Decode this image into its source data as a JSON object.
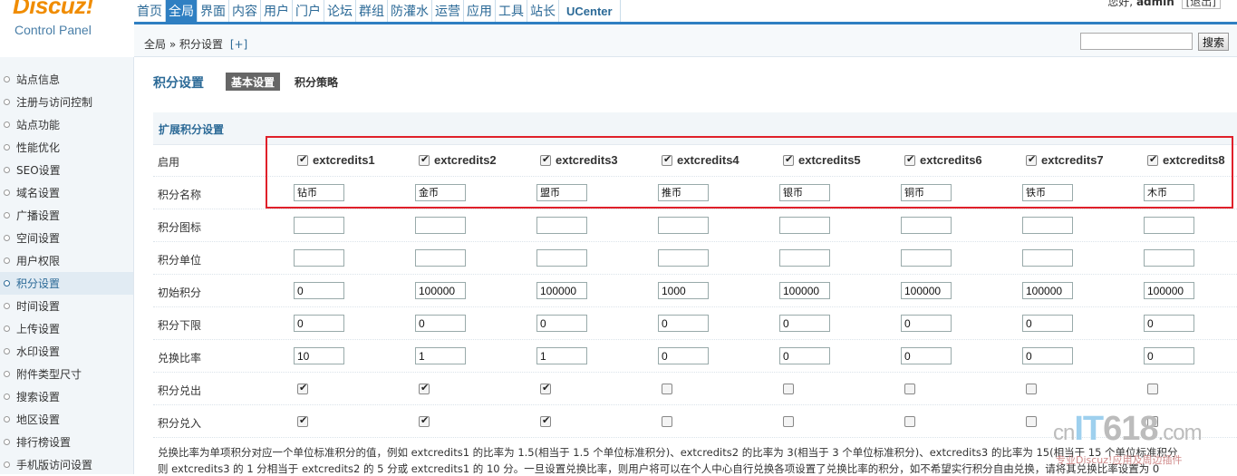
{
  "header": {
    "brand": "Discuz!",
    "subtitle": "Control Panel",
    "nav": [
      "首页",
      "全局",
      "界面",
      "内容",
      "用户",
      "门户",
      "论坛",
      "群组",
      "防灌水",
      "运营",
      "应用",
      "工具",
      "站长",
      "UCenter"
    ],
    "active_nav": "全局",
    "greeting": "您好,",
    "username": "admin",
    "logout": "[退出]"
  },
  "breadcrumb": {
    "text": "全局 » 积分设置",
    "add": "[+]"
  },
  "search": {
    "value": "",
    "button": "搜索"
  },
  "sidebar": {
    "items": [
      "站点信息",
      "注册与访问控制",
      "站点功能",
      "性能优化",
      "SEO设置",
      "域名设置",
      "广播设置",
      "空间设置",
      "用户权限",
      "积分设置",
      "时间设置",
      "上传设置",
      "水印设置",
      "附件类型尺寸",
      "搜索设置",
      "地区设置",
      "排行榜设置",
      "手机版访问设置"
    ],
    "active": "积分设置"
  },
  "page": {
    "title": "积分设置",
    "tabs": [
      "基本设置",
      "积分策略"
    ],
    "active_tab": "基本设置"
  },
  "section": {
    "title": "扩展积分设置"
  },
  "row_labels": {
    "enable": "启用",
    "name": "积分名称",
    "icon": "积分图标",
    "unit": "积分单位",
    "initial": "初始积分",
    "lower": "积分下限",
    "ratio": "兑换比率",
    "out": "积分兑出",
    "in": "积分兑入"
  },
  "credits": [
    {
      "key": "extcredits1",
      "enabled": true,
      "name": "钻币",
      "icon": "",
      "unit": "",
      "initial": "0",
      "lower": "0",
      "ratio": "10",
      "out": true,
      "in": true
    },
    {
      "key": "extcredits2",
      "enabled": true,
      "name": "金币",
      "icon": "",
      "unit": "",
      "initial": "100000",
      "lower": "0",
      "ratio": "1",
      "out": true,
      "in": true
    },
    {
      "key": "extcredits3",
      "enabled": true,
      "name": "盟币",
      "icon": "",
      "unit": "",
      "initial": "100000",
      "lower": "0",
      "ratio": "1",
      "out": true,
      "in": true
    },
    {
      "key": "extcredits4",
      "enabled": true,
      "name": "推币",
      "icon": "",
      "unit": "",
      "initial": "1000",
      "lower": "0",
      "ratio": "0",
      "out": false,
      "in": false
    },
    {
      "key": "extcredits5",
      "enabled": true,
      "name": "银币",
      "icon": "",
      "unit": "",
      "initial": "100000",
      "lower": "0",
      "ratio": "0",
      "out": false,
      "in": false
    },
    {
      "key": "extcredits6",
      "enabled": true,
      "name": "铜币",
      "icon": "",
      "unit": "",
      "initial": "100000",
      "lower": "0",
      "ratio": "0",
      "out": false,
      "in": false
    },
    {
      "key": "extcredits7",
      "enabled": true,
      "name": "铁币",
      "icon": "",
      "unit": "",
      "initial": "100000",
      "lower": "0",
      "ratio": "0",
      "out": false,
      "in": false
    },
    {
      "key": "extcredits8",
      "enabled": true,
      "name": "木币",
      "icon": "",
      "unit": "",
      "initial": "100000",
      "lower": "0",
      "ratio": "0",
      "out": false,
      "in": false
    }
  ],
  "notes": [
    "兑换比率为单项积分对应一个单位标准积分的值，例如 extcredits1 的比率为 1.5(相当于 1.5 个单位标准积分)、extcredits2 的比率为 3(相当于 3 个单位标准积分)、extcredits3 的比率为 15(相当于 15 个单位标准积分",
    "则 extcredits3 的 1 分相当于 extcredits2 的 5 分或 extcredits1 的 10 分。一旦设置兑换比率，则用户将可以在个人中心自行兑换各项设置了兑换比率的积分，如不希望实行积分自由兑换，请将其兑换比率设置为 0"
  ],
  "watermark": {
    "cn": "cn",
    "brand_a": "IT",
    "brand_b": "618",
    "tld": ".com",
    "slogan": "专业Discuz!应用及周边插件"
  },
  "colors": {
    "accent": "#2f7fc2",
    "link": "#2c6a97",
    "highlight_box": "#e0202a",
    "brand_logo": "#f08c00"
  }
}
